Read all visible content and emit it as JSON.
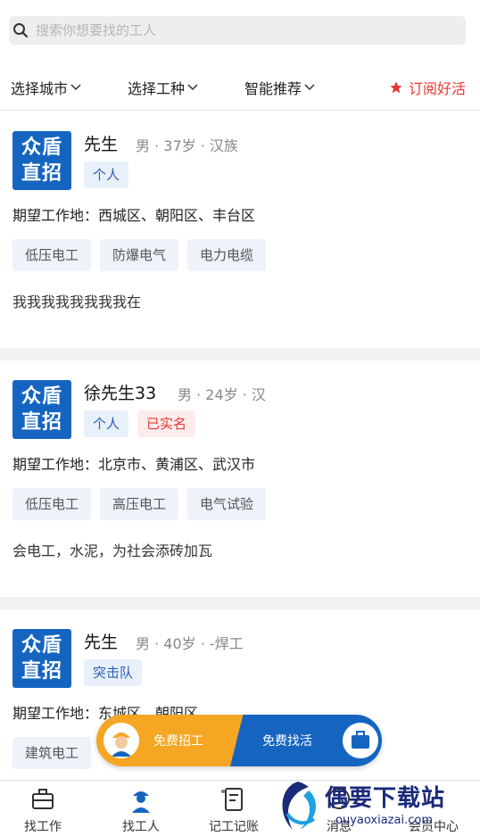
{
  "search": {
    "placeholder": "搜索你想要找的工人"
  },
  "filters": {
    "city": "选择城市",
    "trade": "选择工种",
    "smart": "智能推荐",
    "subscribe": "订阅好活"
  },
  "workers": [
    {
      "logo_line1": "众盾",
      "logo_line2": "直招",
      "name": "先生",
      "meta": "男 · 37岁 · 汉族",
      "tags": [
        "个人"
      ],
      "expect": "期望工作地：西城区、朝阳区、丰台区",
      "skills": [
        "低压电工",
        "防爆电气",
        "电力电缆"
      ],
      "desc": "我我我我我我我我在"
    },
    {
      "logo_line1": "众盾",
      "logo_line2": "直招",
      "name": "徐先生33",
      "meta": "男 · 24岁 · 汉",
      "tags": [
        "个人",
        "已实名"
      ],
      "expect": "期望工作地：北京市、黄浦区、武汉市",
      "skills": [
        "低压电工",
        "高压电工",
        "电气试验"
      ],
      "desc": "会电工，水泥，为社会添砖加瓦"
    },
    {
      "logo_line1": "众盾",
      "logo_line2": "直招",
      "name": "先生",
      "meta": "男 · 40岁 · -焊工",
      "tags": [
        "突击队"
      ],
      "expect": "期望工作地：东城区、朝阳区",
      "skills": [
        "建筑电工"
      ],
      "desc": ""
    }
  ],
  "float_toggle": {
    "left": "免费招工",
    "right": "免费找活"
  },
  "nav": [
    "找工作",
    "找工人",
    "记工记账",
    "消息",
    "会员中心"
  ],
  "watermark": {
    "text": "偶要下载站",
    "url": "ouyaoxiazai.com"
  },
  "colors": {
    "brand": "#1565c0",
    "accent": "#e53935",
    "orange": "#f5a623"
  },
  "icons": [
    "search-icon",
    "chevron-down-icon",
    "star-icon",
    "briefcase-icon",
    "worker-icon",
    "notebook-icon",
    "message-icon"
  ]
}
